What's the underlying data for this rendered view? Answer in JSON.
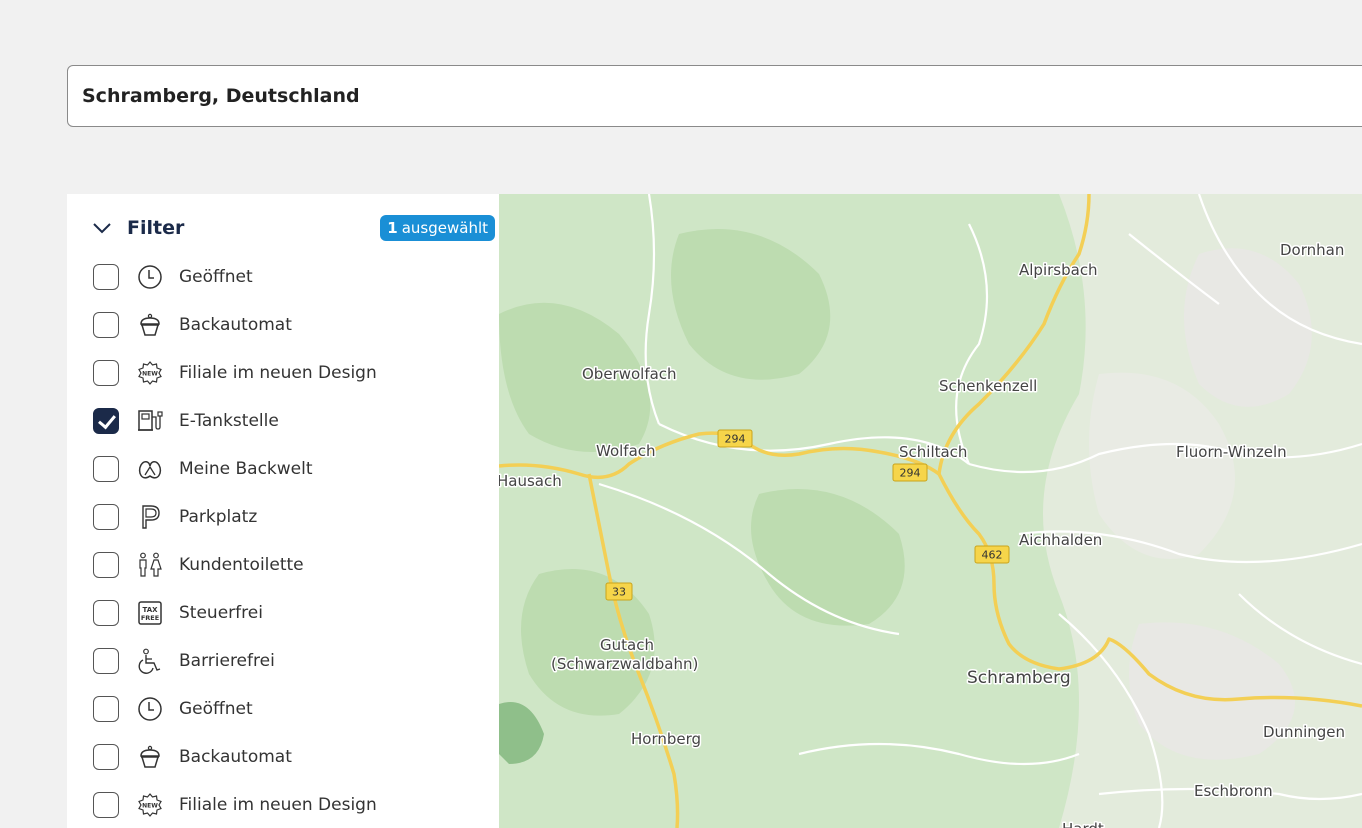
{
  "search": {
    "value": "Schramberg, Deutschland"
  },
  "filter": {
    "title": "Filter",
    "badge_count": "1",
    "badge_text": "ausgewählt",
    "items": [
      {
        "label": "Geöffnet",
        "icon": "clock-icon",
        "checked": false
      },
      {
        "label": "Backautomat",
        "icon": "cupcake-icon",
        "checked": false
      },
      {
        "label": "Filiale im neuen Design",
        "icon": "new-badge-icon",
        "checked": false
      },
      {
        "label": "E-Tankstelle",
        "icon": "ev-charger-icon",
        "checked": true
      },
      {
        "label": "Meine Backwelt",
        "icon": "pretzel-icon",
        "checked": false
      },
      {
        "label": "Parkplatz",
        "icon": "parking-icon",
        "checked": false
      },
      {
        "label": "Kundentoilette",
        "icon": "restroom-icon",
        "checked": false
      },
      {
        "label": "Steuerfrei",
        "icon": "tax-free-icon",
        "checked": false
      },
      {
        "label": "Barrierefrei",
        "icon": "wheelchair-icon",
        "checked": false
      },
      {
        "label": "Geöffnet",
        "icon": "clock-icon",
        "checked": false
      },
      {
        "label": "Backautomat",
        "icon": "cupcake-icon",
        "checked": false
      },
      {
        "label": "Filiale im neuen Design",
        "icon": "new-badge-icon",
        "checked": false
      }
    ]
  },
  "map": {
    "places": [
      "Dornhan",
      "Alpirsbach",
      "Oberwolfach",
      "Schenkenzell",
      "Wolfach",
      "Schiltach",
      "Fluorn-Winzeln",
      "Hausach",
      "Aichhalden",
      "Gutach",
      "(Schwarzwaldbahn)",
      "Schramberg",
      "Hornberg",
      "Dunningen",
      "Eschbronn",
      "Hardt"
    ],
    "roads": [
      "294",
      "294",
      "462",
      "33"
    ],
    "colors": {
      "land": "#cfe6c6",
      "urban": "#e8e8e4",
      "major_road": "#f3cf55",
      "minor_road": "#ffffff"
    }
  }
}
